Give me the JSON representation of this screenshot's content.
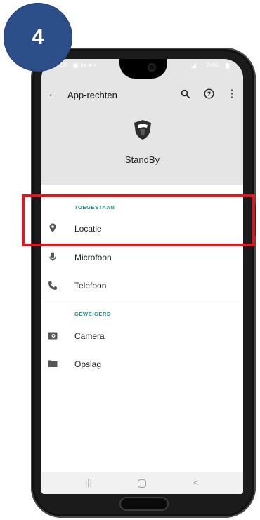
{
  "step_badge": "4",
  "status_bar": {
    "time": "14:00",
    "battery": "74%"
  },
  "toolbar": {
    "title": "App-rechten"
  },
  "app": {
    "name": "StandBy"
  },
  "sections": [
    {
      "header": "TOEGESTAAN",
      "items": [
        {
          "label": "Locatie",
          "icon": "location-pin-icon"
        },
        {
          "label": "Microfoon",
          "icon": "microphone-icon"
        },
        {
          "label": "Telefoon",
          "icon": "phone-icon"
        }
      ]
    },
    {
      "header": "GEWEIGERD",
      "items": [
        {
          "label": "Camera",
          "icon": "camera-icon"
        },
        {
          "label": "Opslag",
          "icon": "folder-icon"
        }
      ]
    }
  ],
  "nav_bar": {
    "recents_glyph": "|||",
    "back_glyph": "<"
  },
  "colors": {
    "accent_teal": "#1a8c86",
    "highlight_red": "#e8141b",
    "badge_blue": "#2c4f8a"
  }
}
